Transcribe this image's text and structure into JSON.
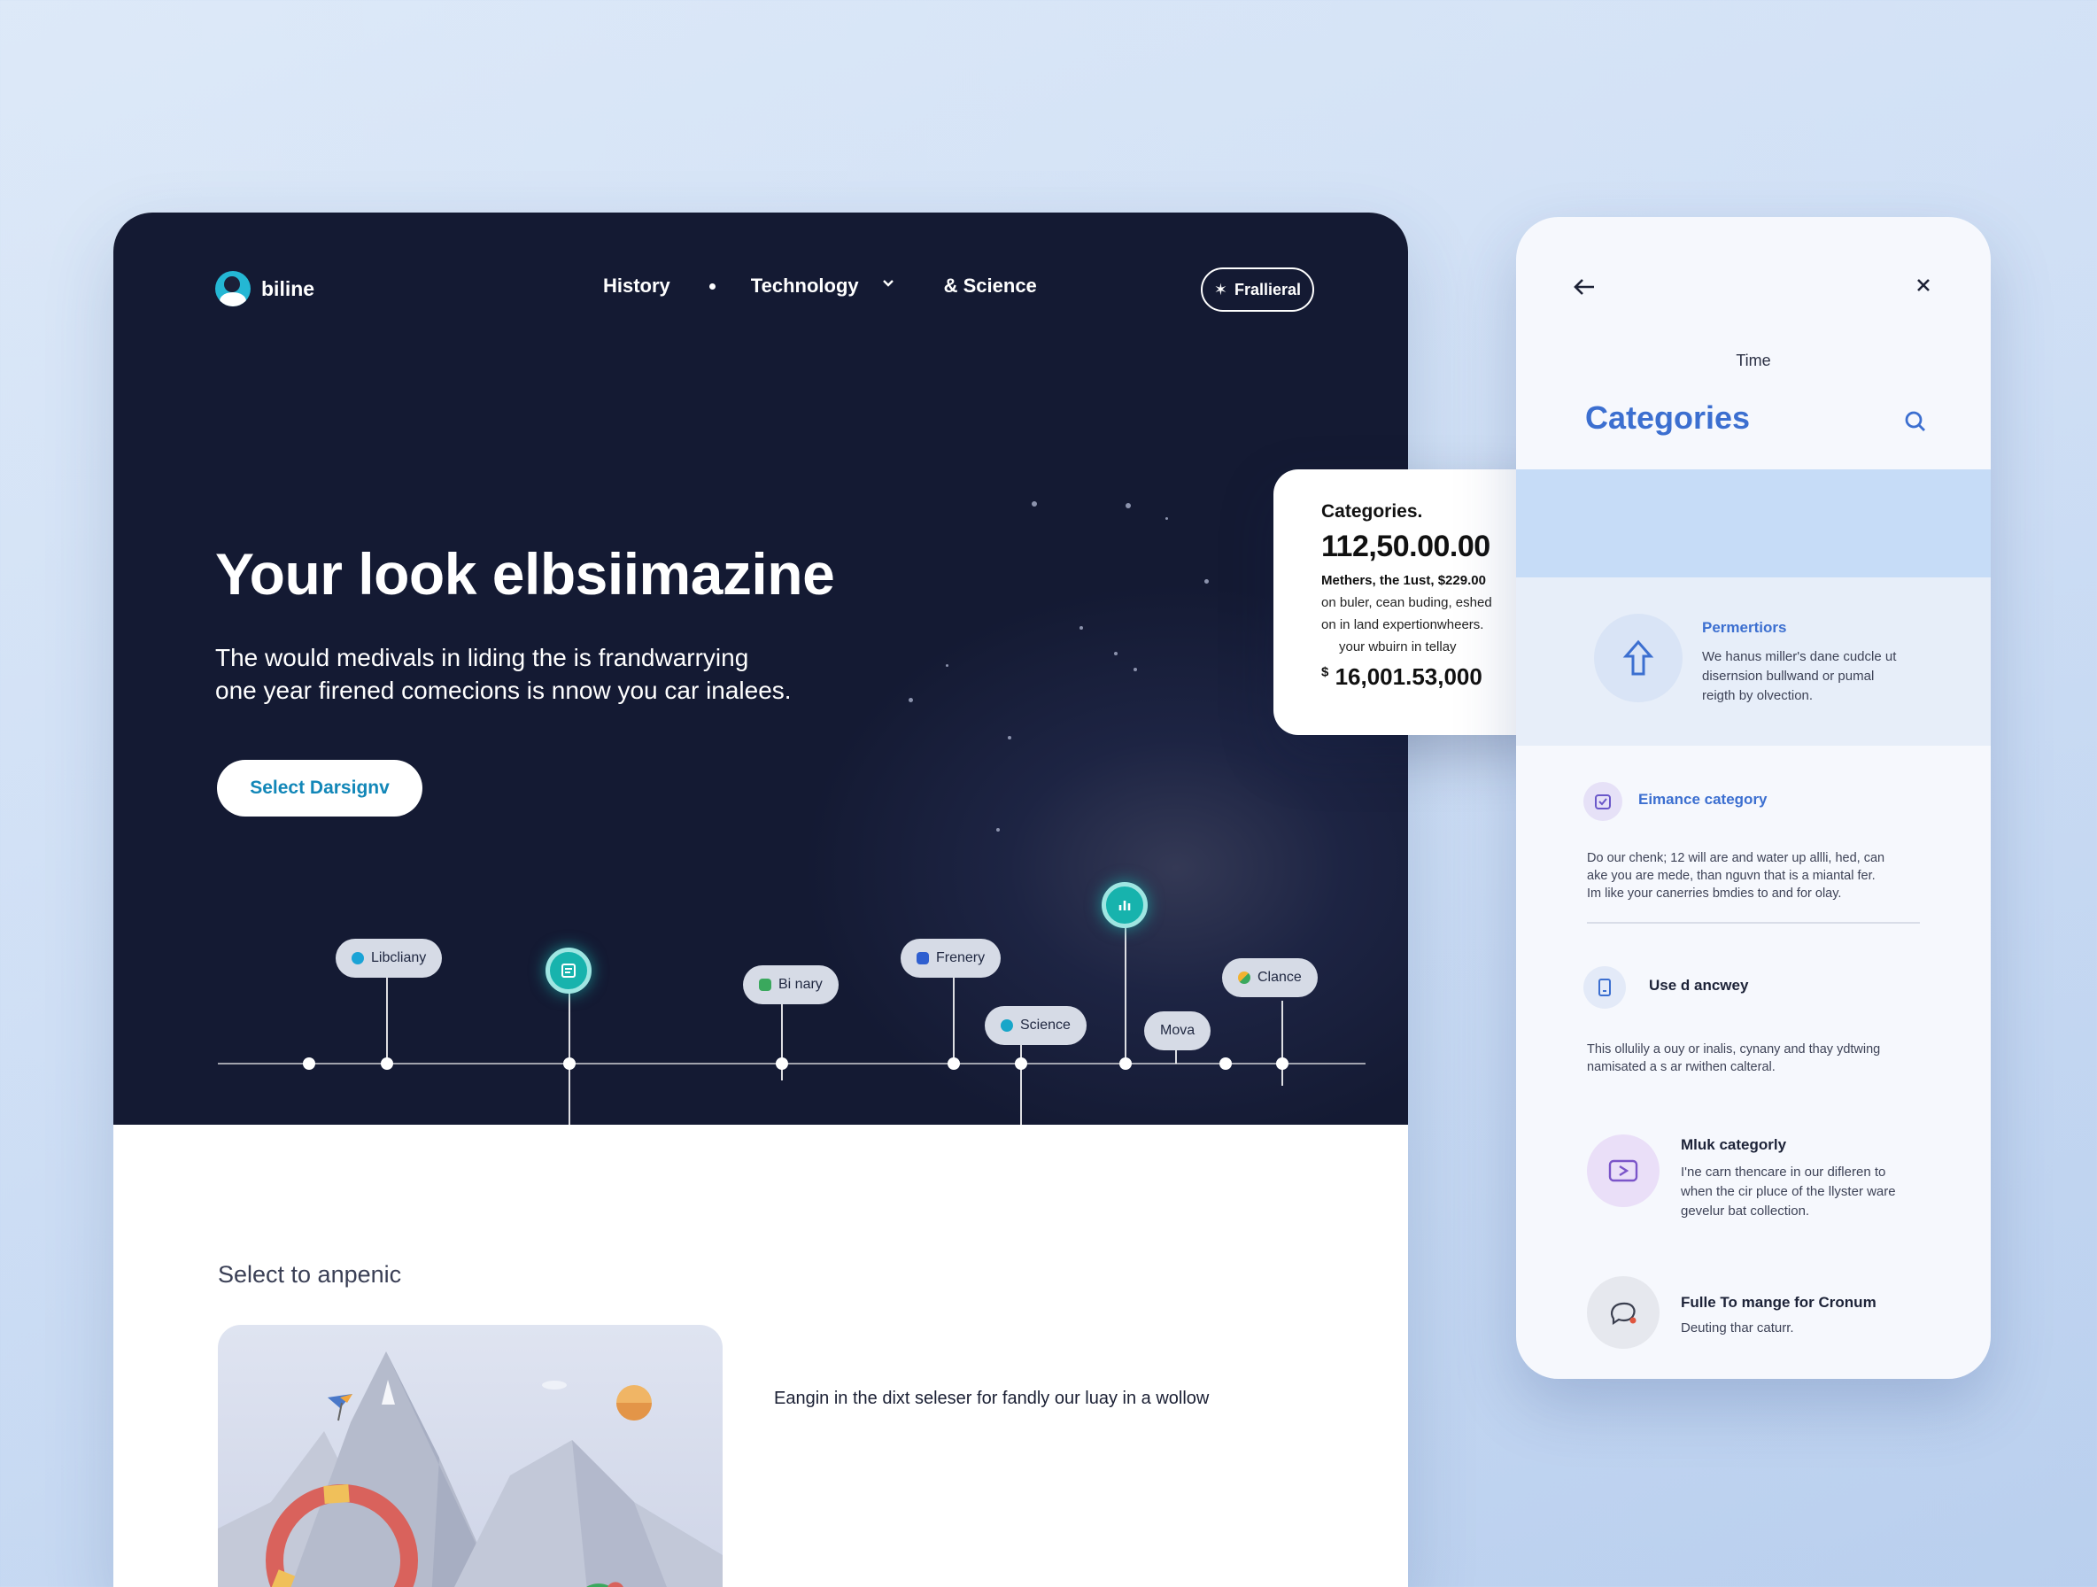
{
  "brand": {
    "name": "biline"
  },
  "nav": {
    "links": [
      "History",
      "Technology",
      "& Science"
    ],
    "cta": "Frallieral"
  },
  "hero": {
    "title": "Your look elbsiimazine",
    "subtitle_line1": "The would medivals in liding the is frandwarrying",
    "subtitle_line2": "one year firened comecions is nnow you car inalees.",
    "button": "Select Darsignv"
  },
  "timeline": {
    "pills": [
      "Libcliany",
      "Bi nary",
      "Frenery",
      "Science",
      "Mova",
      "Clance"
    ]
  },
  "stats_card": {
    "title": "Categories.",
    "amount": "112,50.00.00",
    "line1": "Methers, the 1ust, $229.00",
    "line2": "on buler, cean buding, eshed",
    "line3": "on in land expertionwheers.",
    "line4": "your wbuirn in tellay",
    "amount2_prefix": "$",
    "amount2": "16,001.53,000"
  },
  "section": {
    "label": "Select to anpenic",
    "caption": "Eangin in the dixt seleser for fandly our luay in a wollow"
  },
  "panel": {
    "time": "Time",
    "title": "Categories",
    "items": [
      {
        "title": "Permertiors",
        "text": [
          "We hanus miller's dane cudcle ut",
          "disernsion bullwand or pumal",
          "reigth by olvection."
        ]
      },
      {
        "title": "Eimance category",
        "text": [
          "Do our chenk; 12 will are and water up allli, hed, can",
          "ake you are mede, than nguvn that is a miantal fer.",
          "Im like your canerries bmdies to and for olay."
        ]
      },
      {
        "title": "Use d ancwey",
        "text": [
          "This ollulily a ouy or inalis, cynany and thay ydtwing",
          "namisated a s ar rwithen calteral."
        ]
      },
      {
        "title": "Mluk categorly",
        "text": [
          "I'ne carn thencare in our difleren to",
          "when the cir pluce of the llyster ware",
          "gevelur bat collection."
        ]
      },
      {
        "title": "Fulle To mange for Cronum",
        "text": [
          "Deuting thar caturr."
        ]
      }
    ]
  },
  "colors": {
    "hero_bg": "#1a2040",
    "accent_teal": "#17b3ad",
    "panel_title": "#3c6fd0",
    "button_text": "#1287b8"
  }
}
